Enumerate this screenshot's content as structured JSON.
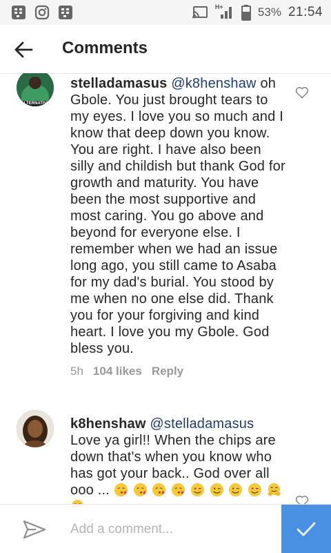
{
  "status_bar": {
    "battery": "53%",
    "time": "21:54",
    "network": "H+"
  },
  "header": {
    "title": "Comments"
  },
  "comments": [
    {
      "username": "stelladamasus",
      "mention": "@k8henshaw",
      "text": " oh Gbole. You just brought tears to my eyes. I love you so much and I know that deep down you know. You are right. I have also been silly and childish but thank God for growth and maturity. You have been the most supportive and most caring. You go above and beyond for everyone else. I remember when we had an issue long ago, you still came to Asaba for my dad's burial. You stood by me when no one else did. Thank you for your forgiving and kind heart. I love you my Gbole. God bless you.",
      "time": "5h",
      "likes": "104 likes",
      "reply": "Reply",
      "avatar_text": "ALTERNATIVE"
    },
    {
      "username": "k8henshaw",
      "mention": "@stelladamasus",
      "text": "Love ya girl!! When the chips are down that's when you know who has got your back.. God over all ooo ... "
    }
  ],
  "composer": {
    "placeholder": "Add a comment..."
  },
  "icons": {
    "back": "arrow-left-icon",
    "like": "heart-outline-icon",
    "send": "paper-plane-icon",
    "post": "checkmark-icon"
  },
  "colors": {
    "accent": "#4a90e2",
    "mention": "#1f3b73",
    "meta": "#999999"
  }
}
